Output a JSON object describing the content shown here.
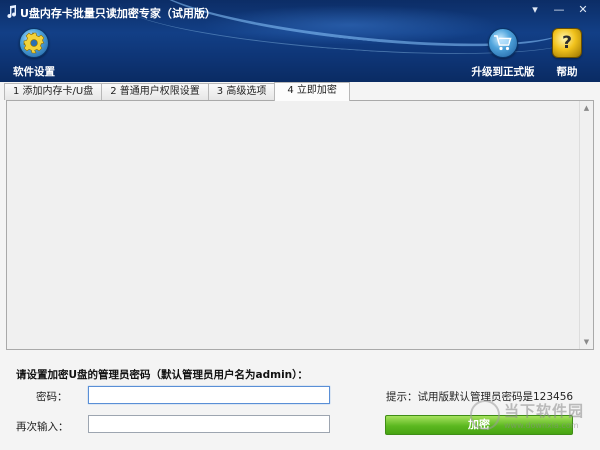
{
  "window": {
    "title": "U盘内存卡批量只读加密专家（试用版）",
    "controls": [
      "▾",
      "—",
      "✕"
    ]
  },
  "toolbar": {
    "settings_label": "软件设置",
    "upgrade_label": "升级到正式版",
    "help_label": "帮助",
    "icons": {
      "settings": "gear-icon",
      "upgrade": "cart-icon",
      "help": "question-icon"
    }
  },
  "tabs": [
    {
      "label": "1 添加内存卡/U盘",
      "active": false
    },
    {
      "label": "2 普通用户权限设置",
      "active": false
    },
    {
      "label": "3 高级选项",
      "active": false
    },
    {
      "label": "4 立即加密",
      "active": true
    }
  ],
  "form": {
    "prompt": "请设置加密U盘的管理员密码（默认管理员用户名为admin）：",
    "password_label": "密码：",
    "password_value": "",
    "confirm_label": "再次输入：",
    "confirm_value": "",
    "hint": "提示：试用版默认管理员密码是123456",
    "submit_label": "加密"
  },
  "watermark": {
    "text": "当下软件园",
    "url": "www.downxia.com"
  },
  "colors": {
    "header": "#123f86",
    "button_green": "#5cb820",
    "panel_bg": "#f0f0f0"
  }
}
